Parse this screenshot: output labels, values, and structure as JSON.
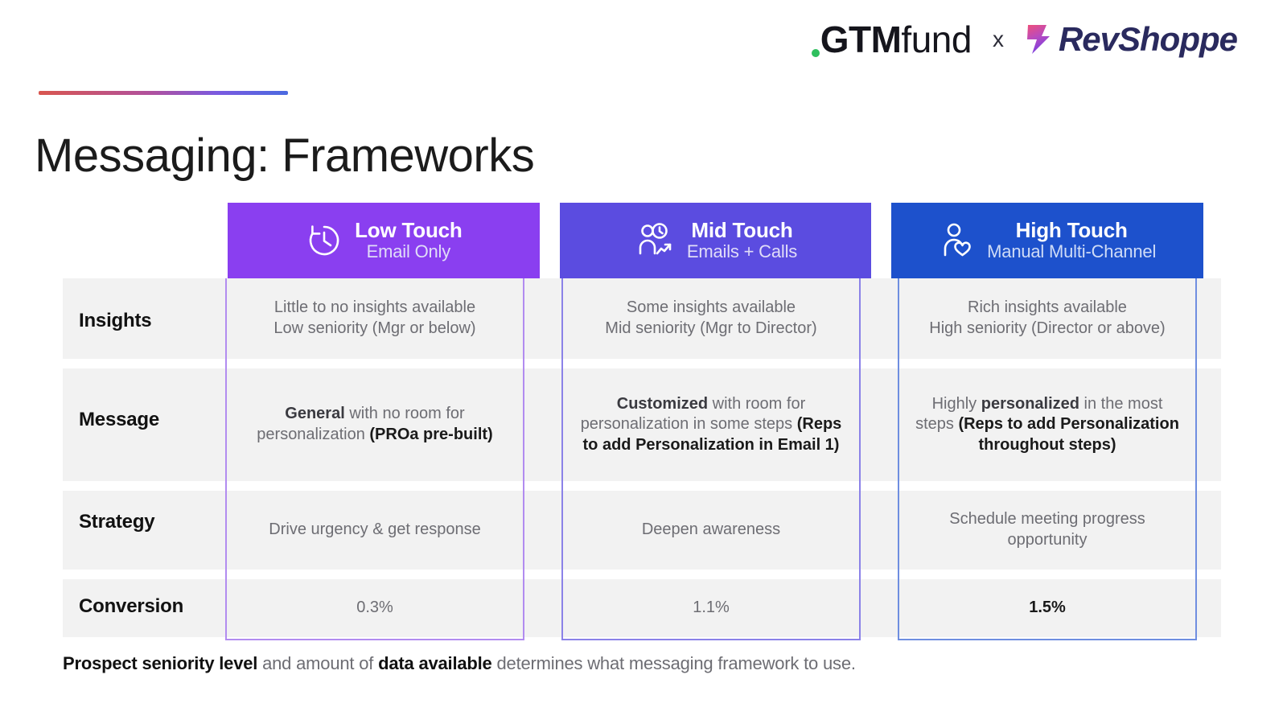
{
  "brand": {
    "gtm_bold": "GTM",
    "gtm_light": "fund",
    "separator": "x",
    "revshoppe": "RevShoppe",
    "dot_color": "#2fbf5e",
    "bolt_gradient_from": "#e8527f",
    "bolt_gradient_to": "#7a3fe0"
  },
  "title": "Messaging: Frameworks",
  "accent_rule": {
    "from": "#d9564f",
    "to": "#4a6ae0"
  },
  "columns": [
    {
      "id": "low-touch",
      "title": "Low Touch",
      "subtitle": "Email Only",
      "icon": "clock-history-icon",
      "color": "#8a3ff0",
      "border_color": "#b28cf0"
    },
    {
      "id": "mid-touch",
      "title": "Mid Touch",
      "subtitle": "Emails + Calls",
      "icon": "person-clock-trend-icon",
      "color": "#5b4ce0",
      "border_color": "#8b82e8"
    },
    {
      "id": "high-touch",
      "title": "High Touch",
      "subtitle": "Manual Multi-Channel",
      "icon": "person-heart-icon",
      "color": "#1d51cc",
      "border_color": "#6f8ee0"
    }
  ],
  "rows": [
    {
      "id": "insights",
      "label": "Insights"
    },
    {
      "id": "message",
      "label": "Message"
    },
    {
      "id": "strategy",
      "label": "Strategy"
    },
    {
      "id": "conversion",
      "label": "Conversion"
    }
  ],
  "cells": {
    "insights": {
      "low": {
        "line1": "Little to no insights available",
        "line2": "Low seniority (Mgr or below)"
      },
      "mid": {
        "line1": "Some insights available",
        "line2": "Mid seniority (Mgr to Director)"
      },
      "high": {
        "line1": "Rich insights available",
        "line2": "High seniority (Director or above)"
      }
    },
    "message": {
      "low": {
        "emph": "General",
        "plain": " with no room for personalization ",
        "bold": "(PROa pre-built)"
      },
      "mid": {
        "emph": "Customized",
        "plain": " with room for personalization in some steps ",
        "bold": "(Reps to add Personalization in Email 1)"
      },
      "high": {
        "pre": "Highly ",
        "emph": "personalized",
        "plain": " in the most steps ",
        "bold": "(Reps to add Personalization throughout steps)"
      }
    },
    "strategy": {
      "low": "Drive urgency & get response",
      "mid": "Deepen awareness",
      "high": "Schedule meeting progress opportunity"
    },
    "conversion": {
      "low": "0.3%",
      "mid": "1.1%",
      "high": "1.5%"
    }
  },
  "footer": {
    "bold1": "Prospect seniority level",
    "mid": " and amount of ",
    "bold2": "data available",
    "tail": " determines what messaging framework to use."
  }
}
